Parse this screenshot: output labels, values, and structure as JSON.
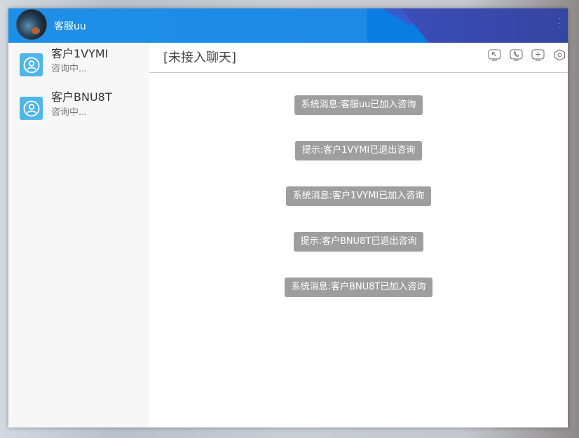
{
  "header": {
    "agent_name": "客服uu"
  },
  "sidebar": {
    "contacts": [
      {
        "name": "客户1VYMI",
        "status": "咨询中..."
      },
      {
        "name": "客户BNU8T",
        "status": "咨询中..."
      }
    ]
  },
  "chat": {
    "title": "[未接入聊天]",
    "toolbar": {
      "icons": [
        "exit-icon",
        "phone-icon",
        "add-icon",
        "settings-icon"
      ]
    },
    "messages": [
      "系统消息:客服uu已加入咨询",
      "提示:客户1VYMI已退出咨询",
      "系统消息:客户1VYMI已加入咨询",
      "提示:客户BNU8T已退出咨询",
      "系统消息:客户BNU8T已加入咨询"
    ]
  },
  "colors": {
    "header_blue": "#1e8fe6",
    "contact_icon": "#4fb6e6",
    "system_message_bg": "#9e9e9e"
  }
}
